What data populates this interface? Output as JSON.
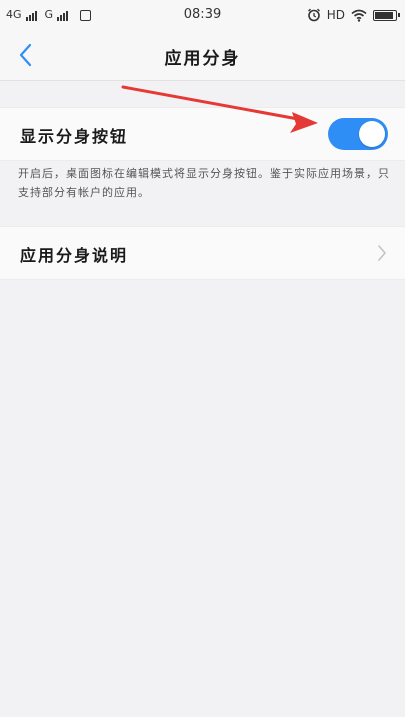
{
  "status_bar": {
    "net1": "4G",
    "net2": "G",
    "time": "08:39",
    "hd": "HD"
  },
  "header": {
    "title": "应用分身"
  },
  "settings": {
    "toggle_label": "显示分身按钮",
    "toggle_state": "on",
    "description": "开启后，桌面图标在编辑模式将显示分身按钮。鉴于实际应用场景，只支持部分有帐户的应用。",
    "explain_label": "应用分身说明"
  },
  "colors": {
    "accent": "#2f8ef5",
    "annotation": "#e53935"
  }
}
